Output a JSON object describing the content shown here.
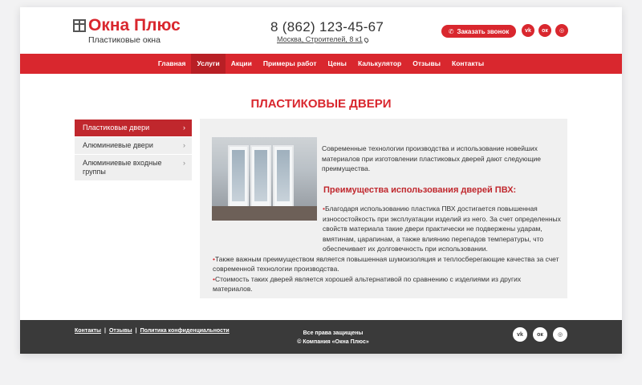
{
  "brand": {
    "title": "Окна Плюс",
    "subtitle": "Пластиковые окна",
    "accent_color": "#d9272e"
  },
  "contact": {
    "phone": "8 (862) 123-45-67",
    "address": "Москва, Строителей, 8 к1"
  },
  "callback_button": {
    "label": "Заказать звонок",
    "icon": "phone-icon"
  },
  "social": [
    "vk",
    "ok",
    "instagram"
  ],
  "nav": {
    "items": [
      {
        "label": "Главная"
      },
      {
        "label": "Услуги"
      },
      {
        "label": "Акции"
      },
      {
        "label": "Примеры работ"
      },
      {
        "label": "Цены"
      },
      {
        "label": "Калькулятор"
      },
      {
        "label": "Отзывы"
      },
      {
        "label": "Контакты"
      }
    ],
    "active": "Услуги"
  },
  "page": {
    "heading": "ПЛАСТИКОВЫЕ ДВЕРИ"
  },
  "sidebar": {
    "items": [
      {
        "label": "Пластиковые двери"
      },
      {
        "label": "Алюминиевые двери"
      },
      {
        "label": "Алюминиевые входные группы"
      }
    ],
    "active": "Пластиковые двери"
  },
  "content": {
    "intro": "Современные технологии производства и использование новейших материалов при изготовлении пластиковых дверей дают следующие преимущества.",
    "subheading": "Преимущества использования дверей ПВХ:",
    "bullets": [
      "Благодаря использованию пластика ПВХ достигается повышенная износостойкость при эксплуатации изделий из него. За счет определенных свойств материала такие двери практически не подвержены ударам, вмятинам, царапинам, а также влиянию перепадов температуры, что обеспечивает их долговечность при использовании.",
      "Также важным преимуществом является повышенная шумоизоляция и теплосберегающие качества за счет современной технологии производства.",
      "Стоимость таких дверей является хорошей альтернативой по сравнению с изделиями из других материалов."
    ]
  },
  "footer": {
    "links": [
      {
        "label": "Контакты"
      },
      {
        "label": "Отзывы"
      },
      {
        "label": "Политика конфиденциальности"
      }
    ],
    "rights": "Все права защищены",
    "copyright": "© Компания «Окна Плюс»"
  }
}
